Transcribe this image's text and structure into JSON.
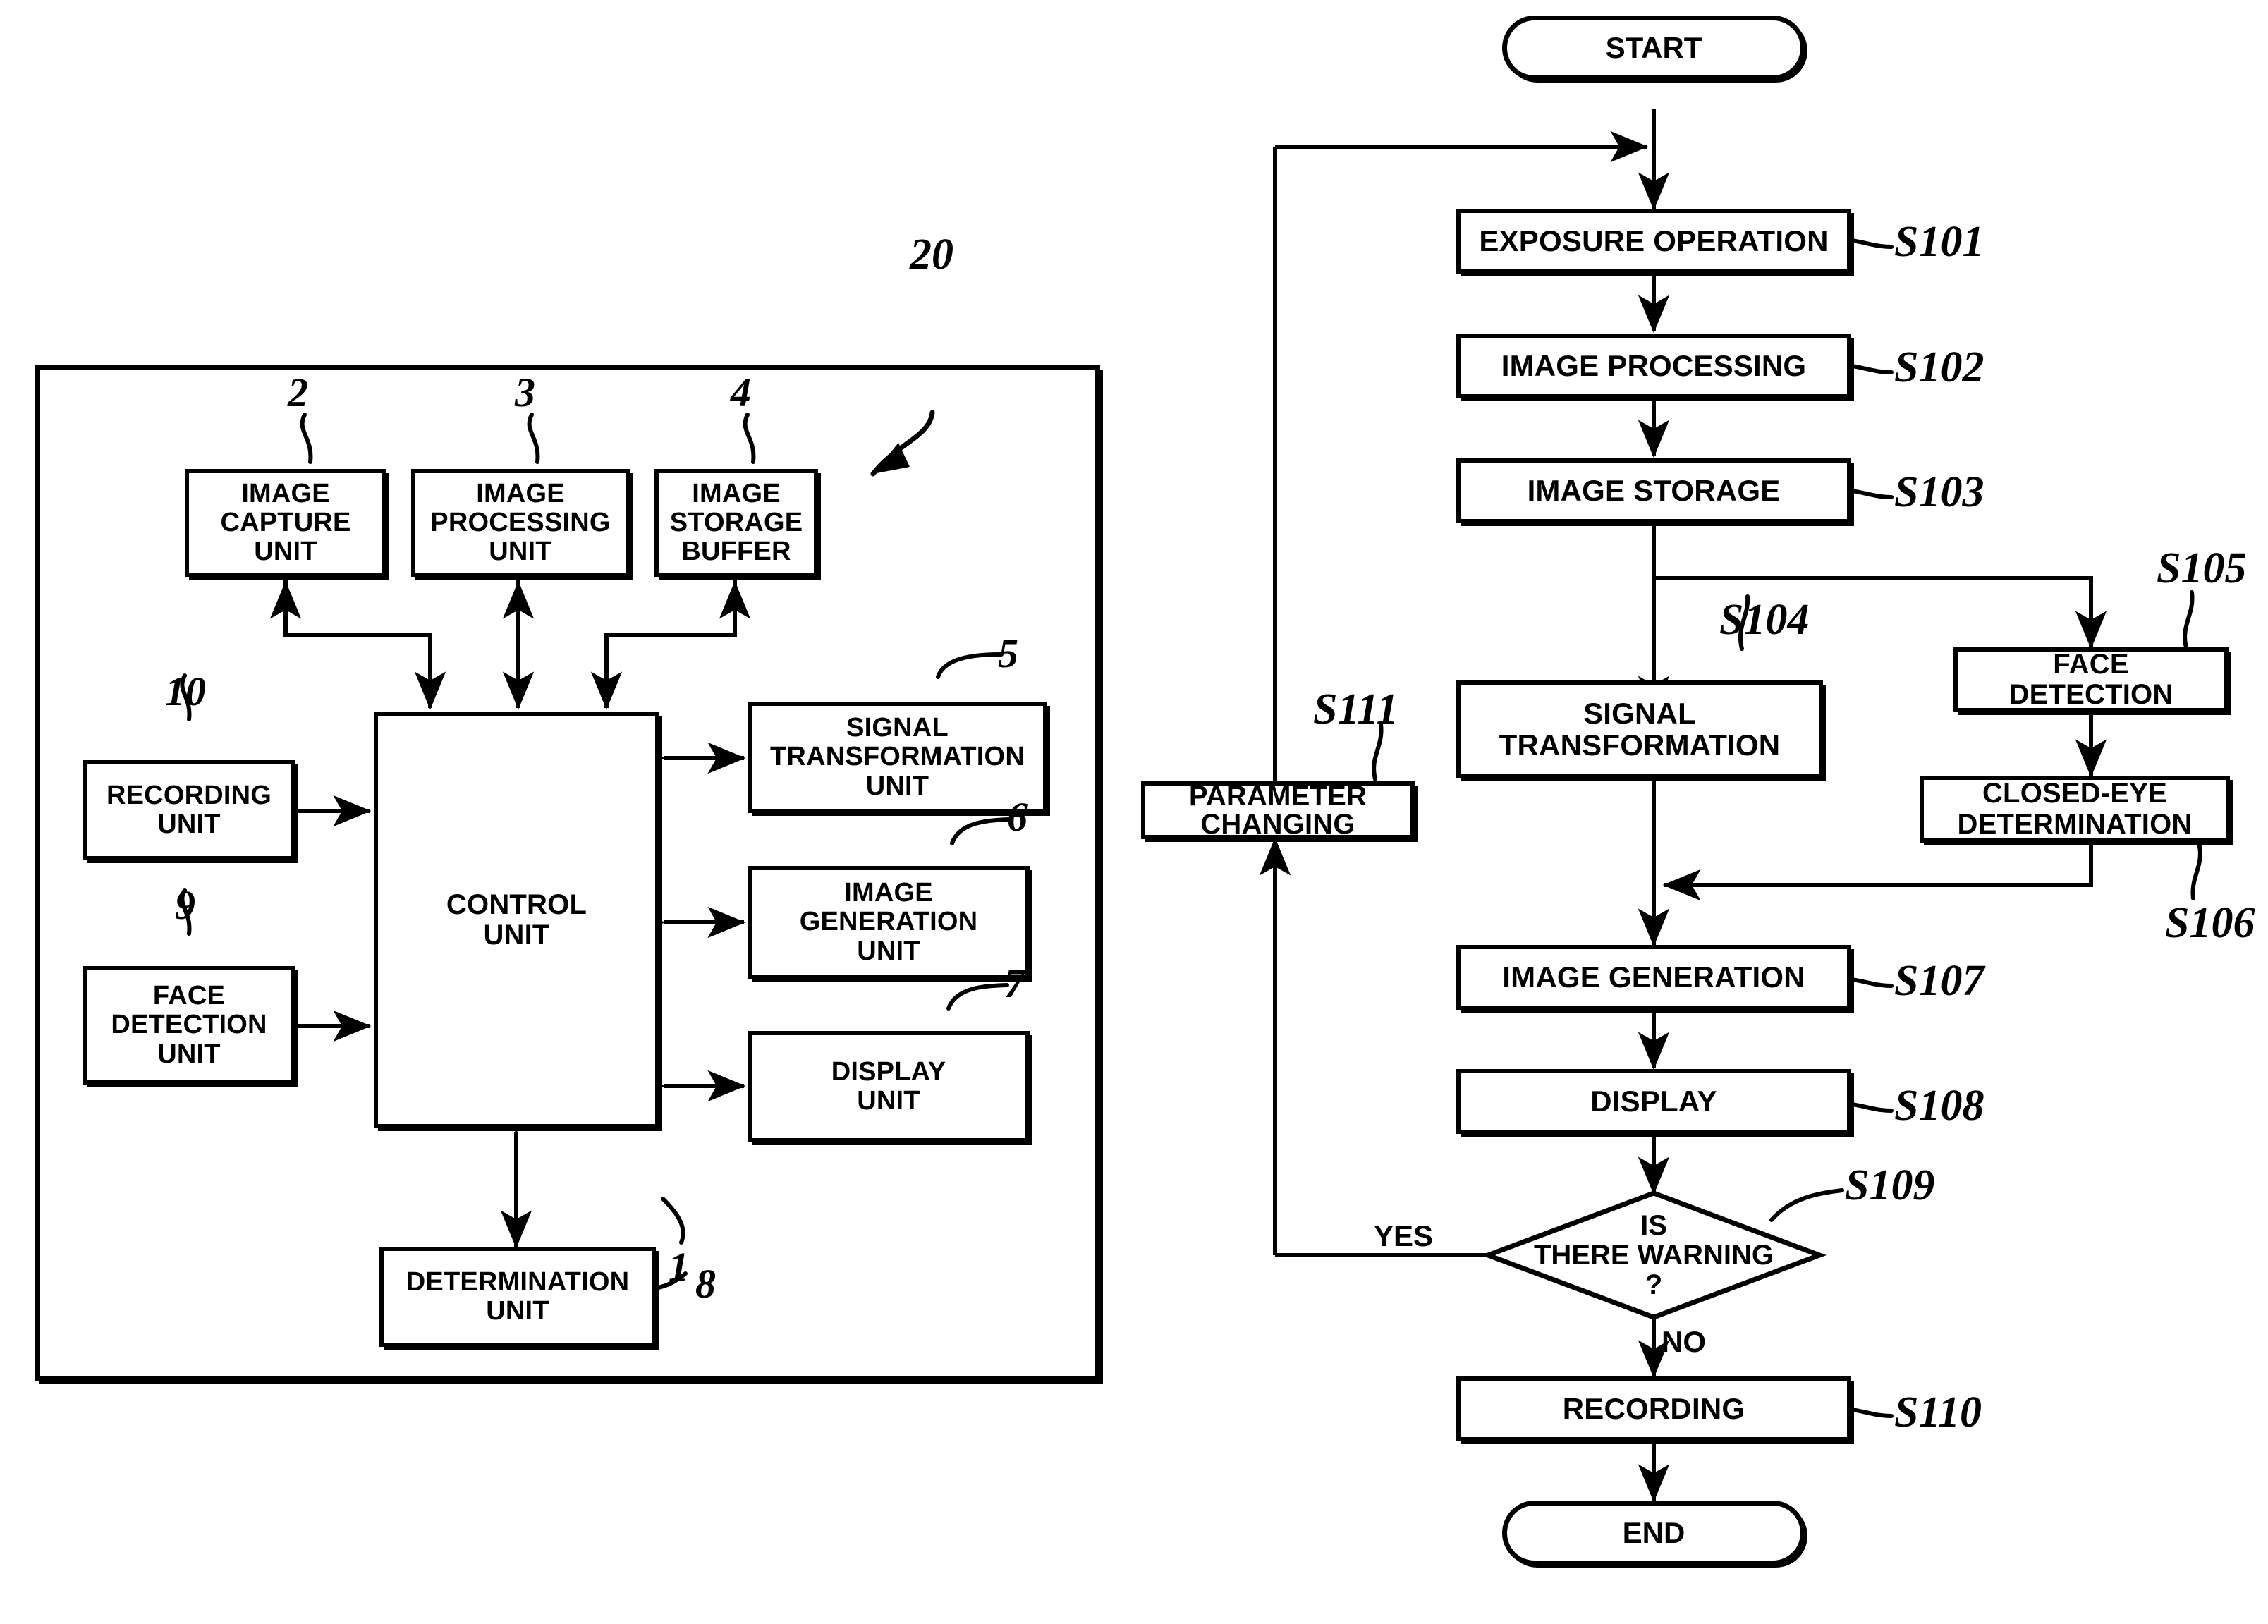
{
  "figure": {
    "kind": "patent-figure",
    "panels": [
      "block-diagram",
      "flowchart"
    ]
  },
  "block_diagram": {
    "enclosure_ref": "20",
    "blocks": [
      {
        "id": "image-capture-unit",
        "label": "IMAGE\nCAPTURE\nUNIT",
        "ref": "2"
      },
      {
        "id": "image-processing-unit",
        "label": "IMAGE\nPROCESSING\nUNIT",
        "ref": "3"
      },
      {
        "id": "image-storage-buffer",
        "label": "IMAGE\nSTORAGE\nBUFFER",
        "ref": "4"
      },
      {
        "id": "signal-transformation-unit",
        "label": "SIGNAL\nTRANSFORMATION\nUNIT",
        "ref": "5"
      },
      {
        "id": "image-generation-unit",
        "label": "IMAGE\nGENERATION\nUNIT",
        "ref": "6"
      },
      {
        "id": "display-unit",
        "label": "DISPLAY\nUNIT",
        "ref": "7"
      },
      {
        "id": "determination-unit",
        "label": "DETERMINATION\nUNIT",
        "ref": "8"
      },
      {
        "id": "face-detection-unit",
        "label": "FACE\nDETECTION\nUNIT",
        "ref": "9"
      },
      {
        "id": "recording-unit",
        "label": "RECORDING\nUNIT",
        "ref": "10"
      },
      {
        "id": "control-unit",
        "label": "CONTROL\nUNIT",
        "ref": "1"
      }
    ]
  },
  "flowchart": {
    "start_label": "START",
    "end_label": "END",
    "yes_label": "YES",
    "no_label": "NO",
    "steps": [
      {
        "id": "s101",
        "label": "EXPOSURE OPERATION",
        "ref": "S101"
      },
      {
        "id": "s102",
        "label": "IMAGE PROCESSING",
        "ref": "S102"
      },
      {
        "id": "s103",
        "label": "IMAGE STORAGE",
        "ref": "S103"
      },
      {
        "id": "s104",
        "label": "SIGNAL\nTRANSFORMATION",
        "ref": "S104"
      },
      {
        "id": "s105",
        "label": "FACE\nDETECTION",
        "ref": "S105"
      },
      {
        "id": "s106",
        "label": "CLOSED-EYE\nDETERMINATION",
        "ref": "S106"
      },
      {
        "id": "s107",
        "label": "IMAGE GENERATION",
        "ref": "S107"
      },
      {
        "id": "s108",
        "label": "DISPLAY",
        "ref": "S108"
      },
      {
        "id": "s109",
        "label": "IS\nTHERE WARNING\n?",
        "ref": "S109"
      },
      {
        "id": "s110",
        "label": "RECORDING",
        "ref": "S110"
      },
      {
        "id": "s111",
        "label": "PARAMETER\nCHANGING",
        "ref": "S111"
      }
    ]
  },
  "colors": {
    "ink": "#000000",
    "paper": "#ffffff"
  }
}
